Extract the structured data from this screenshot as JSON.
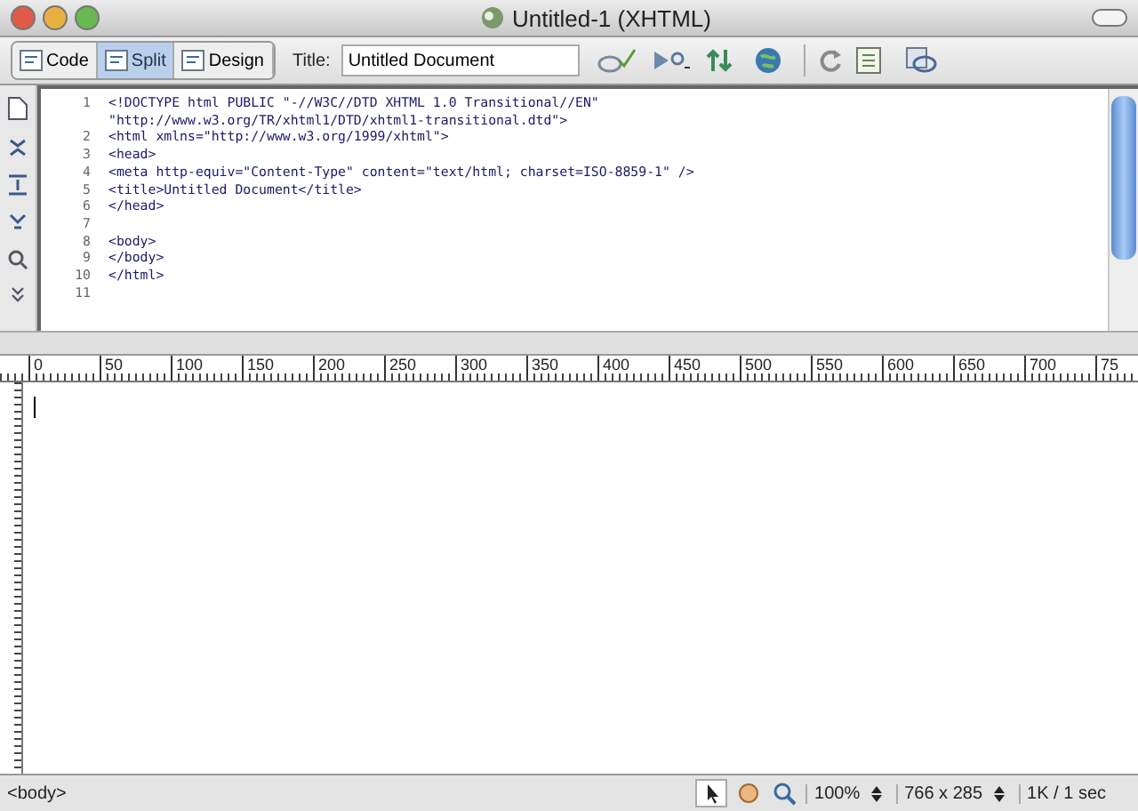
{
  "window": {
    "title": "Untitled-1 (XHTML)"
  },
  "view_buttons": [
    {
      "label": "Code",
      "selected": false
    },
    {
      "label": "Split",
      "selected": true
    },
    {
      "label": "Design",
      "selected": false
    }
  ],
  "title_field": {
    "label": "Title:",
    "value": "Untitled Document"
  },
  "code": {
    "lines": [
      {
        "number": "1",
        "text": "<!DOCTYPE html PUBLIC \"-//W3C//DTD XHTML 1.0 Transitional//EN\"",
        "continuation": "\"http://www.w3.org/TR/xhtml1/DTD/xhtml1-transitional.dtd\">"
      },
      {
        "number": "2",
        "text": "<html xmlns=\"http://www.w3.org/1999/xhtml\">"
      },
      {
        "number": "3",
        "text": "<head>"
      },
      {
        "number": "4",
        "text": "<meta http-equiv=\"Content-Type\" content=\"text/html; charset=ISO-8859-1\" />"
      },
      {
        "number": "5",
        "text": "<title>Untitled Document</title>"
      },
      {
        "number": "6",
        "text": "</head>"
      },
      {
        "number": "7"
      },
      {
        "number": "8",
        "text": "<body>"
      },
      {
        "number": "9",
        "text": "</body>"
      },
      {
        "number": "10",
        "text": "</html>"
      },
      {
        "number": "11"
      }
    ]
  },
  "ruler": {
    "labels": [
      "0",
      "50",
      "100",
      "150",
      "200",
      "250",
      "300",
      "350",
      "400",
      "450",
      "500",
      "550",
      "600",
      "650",
      "700",
      "75"
    ]
  },
  "status_bar": {
    "tag": "<body>",
    "zoom": "100%",
    "size": "766 x 285",
    "download": "1K / 1 sec"
  }
}
